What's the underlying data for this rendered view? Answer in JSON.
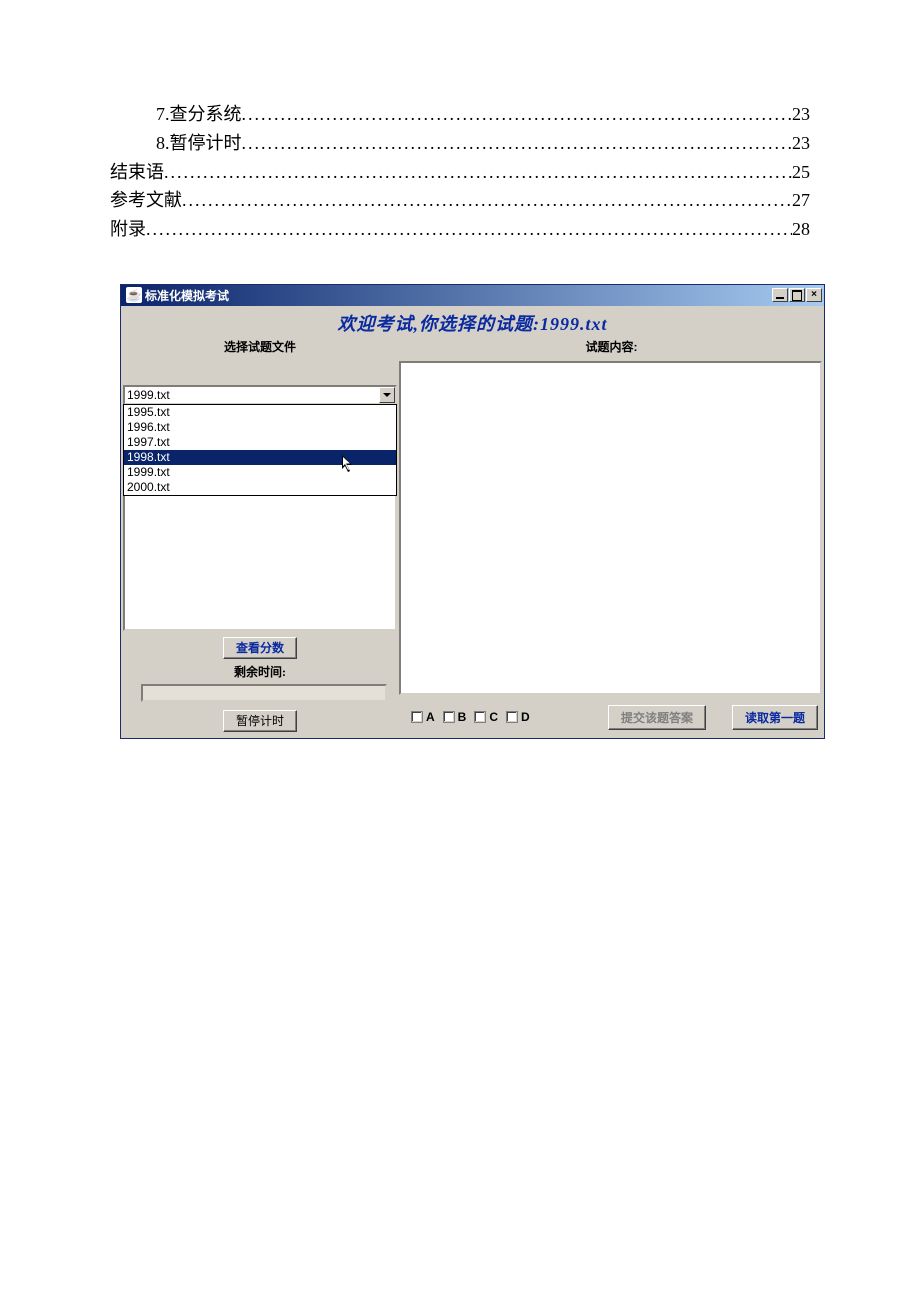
{
  "toc": [
    {
      "label": "7.查分系统",
      "page": "23",
      "indent": true
    },
    {
      "label": "8.暂停计时",
      "page": "23",
      "indent": true
    },
    {
      "label": "结束语",
      "page": "25",
      "indent": false
    },
    {
      "label": "参考文献",
      "page": "27",
      "indent": false
    },
    {
      "label": "附录",
      "page": "28",
      "indent": false
    }
  ],
  "app": {
    "title": "标准化模拟考试",
    "welcome": "欢迎考试,你选择的试题:1999.txt",
    "left_label": "选择试题文件",
    "right_label": "试题内容:",
    "combo_value": "1999.txt",
    "dropdown": [
      {
        "text": "1995.txt",
        "hl": false
      },
      {
        "text": "1996.txt",
        "hl": false
      },
      {
        "text": "1997.txt",
        "hl": false
      },
      {
        "text": "1998.txt",
        "hl": true
      },
      {
        "text": "1999.txt",
        "hl": false
      },
      {
        "text": "2000.txt",
        "hl": false
      }
    ],
    "score_btn": "查看分数",
    "remain_label": "剩余时间:",
    "pause_btn": "暂停计时",
    "choices": [
      "A",
      "B",
      "C",
      "D"
    ],
    "submit_btn": "提交该题答案",
    "read_btn": "读取第一题"
  }
}
